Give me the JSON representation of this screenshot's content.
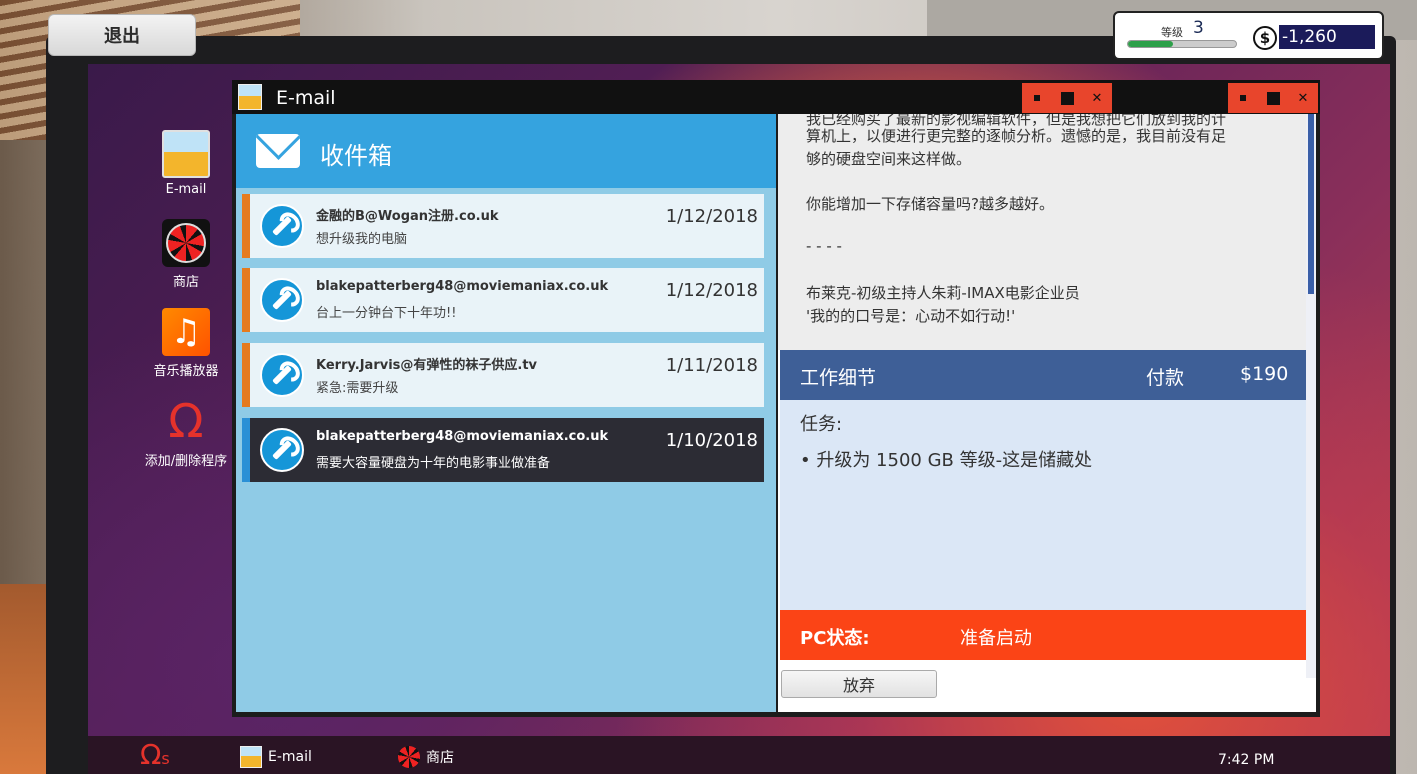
{
  "exit_button": "退出",
  "hud": {
    "level_label": "等级",
    "level": "3",
    "xp_progress": 0.42,
    "currency_icon": "$",
    "money": "-1,260"
  },
  "desktop_icons": [
    {
      "label": "E-mail",
      "icon": "envelope-icon"
    },
    {
      "label": "商店",
      "icon": "fan-icon"
    },
    {
      "label": "音乐播放器",
      "icon": "music-note-icon"
    },
    {
      "label": "添加/删除程序",
      "icon": "omega-icon"
    }
  ],
  "window": {
    "title": "E-mail",
    "background_title": "商店"
  },
  "inbox": {
    "title": "收件箱",
    "emails": [
      {
        "sender": "金融的B@Wogan注册.co.uk",
        "subject": "想升级我的电脑",
        "date": "1/12/2018"
      },
      {
        "sender": "blakepatterberg48@moviemaniax.co.uk",
        "subject": "台上一分钟台下十年功!!",
        "date": "1/12/2018"
      },
      {
        "sender": "Kerry.Jarvis@有弹性的袜子供应.tv",
        "subject": "紧急:需要升级",
        "date": "1/11/2018"
      },
      {
        "sender": "blakepatterberg48@moviemaniax.co.uk",
        "subject": "需要大容量硬盘为十年的电影事业做准备",
        "date": "1/10/2018"
      }
    ]
  },
  "message": {
    "lines": [
      "我已经购买了最新的影视编辑软件，但是我想把它们放到我的计",
      "算机上，以便进行更完整的逐帧分析。遗憾的是，我目前没有足",
      "够的硬盘空间来这样做。",
      "你能增加一下存储容量吗?越多越好。",
      "- - - -",
      "布莱克-初级主持人朱莉-IMAX电影企业员",
      "'我的的口号是：心动不如行动!'"
    ]
  },
  "job": {
    "title": "工作细节",
    "pay_label": "付款",
    "pay_value": "$190",
    "task_label": "任务:",
    "task_item": "• 升级为 1500 GB 等级-这是储藏处"
  },
  "pc_status": {
    "label": "PC状态:",
    "value": "准备启动"
  },
  "abandon_button": "放弃",
  "taskbar": {
    "start_symbol": "Ω",
    "start_suffix": "s",
    "items": [
      {
        "label": "E-mail"
      },
      {
        "label": "商店"
      }
    ],
    "clock": "7:42 PM"
  }
}
